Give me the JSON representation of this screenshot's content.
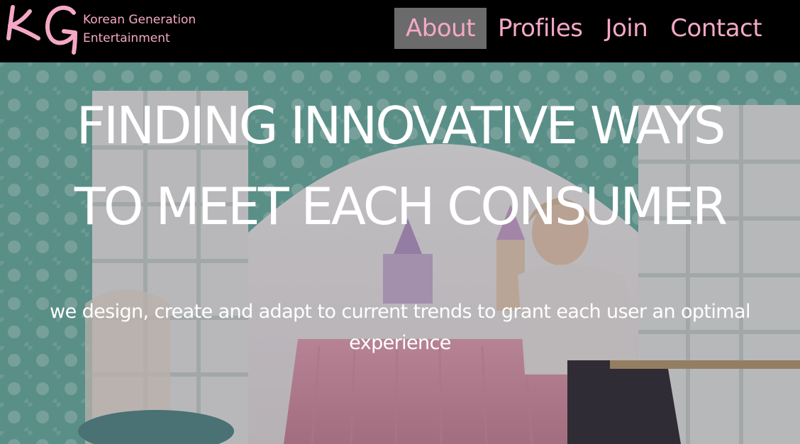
{
  "brand": {
    "logo_letters": "KG",
    "name_line1": "Korean Generation",
    "name_line2": "Entertainment",
    "color": "#f4a8c6"
  },
  "nav": {
    "items": [
      {
        "label": "About",
        "active": true
      },
      {
        "label": "Profiles",
        "active": false
      },
      {
        "label": "Join",
        "active": false
      },
      {
        "label": "Contact",
        "active": false
      }
    ],
    "active_bg": "#6b6b6b"
  },
  "hero": {
    "title_line1": "FINDING INNOVATIVE WAYS",
    "title_line2": "TO MEET EACH CONSUMER",
    "subtitle_line1": "we design, create and adapt to current trends to grant each user an optimal",
    "subtitle_line2": "experience"
  }
}
